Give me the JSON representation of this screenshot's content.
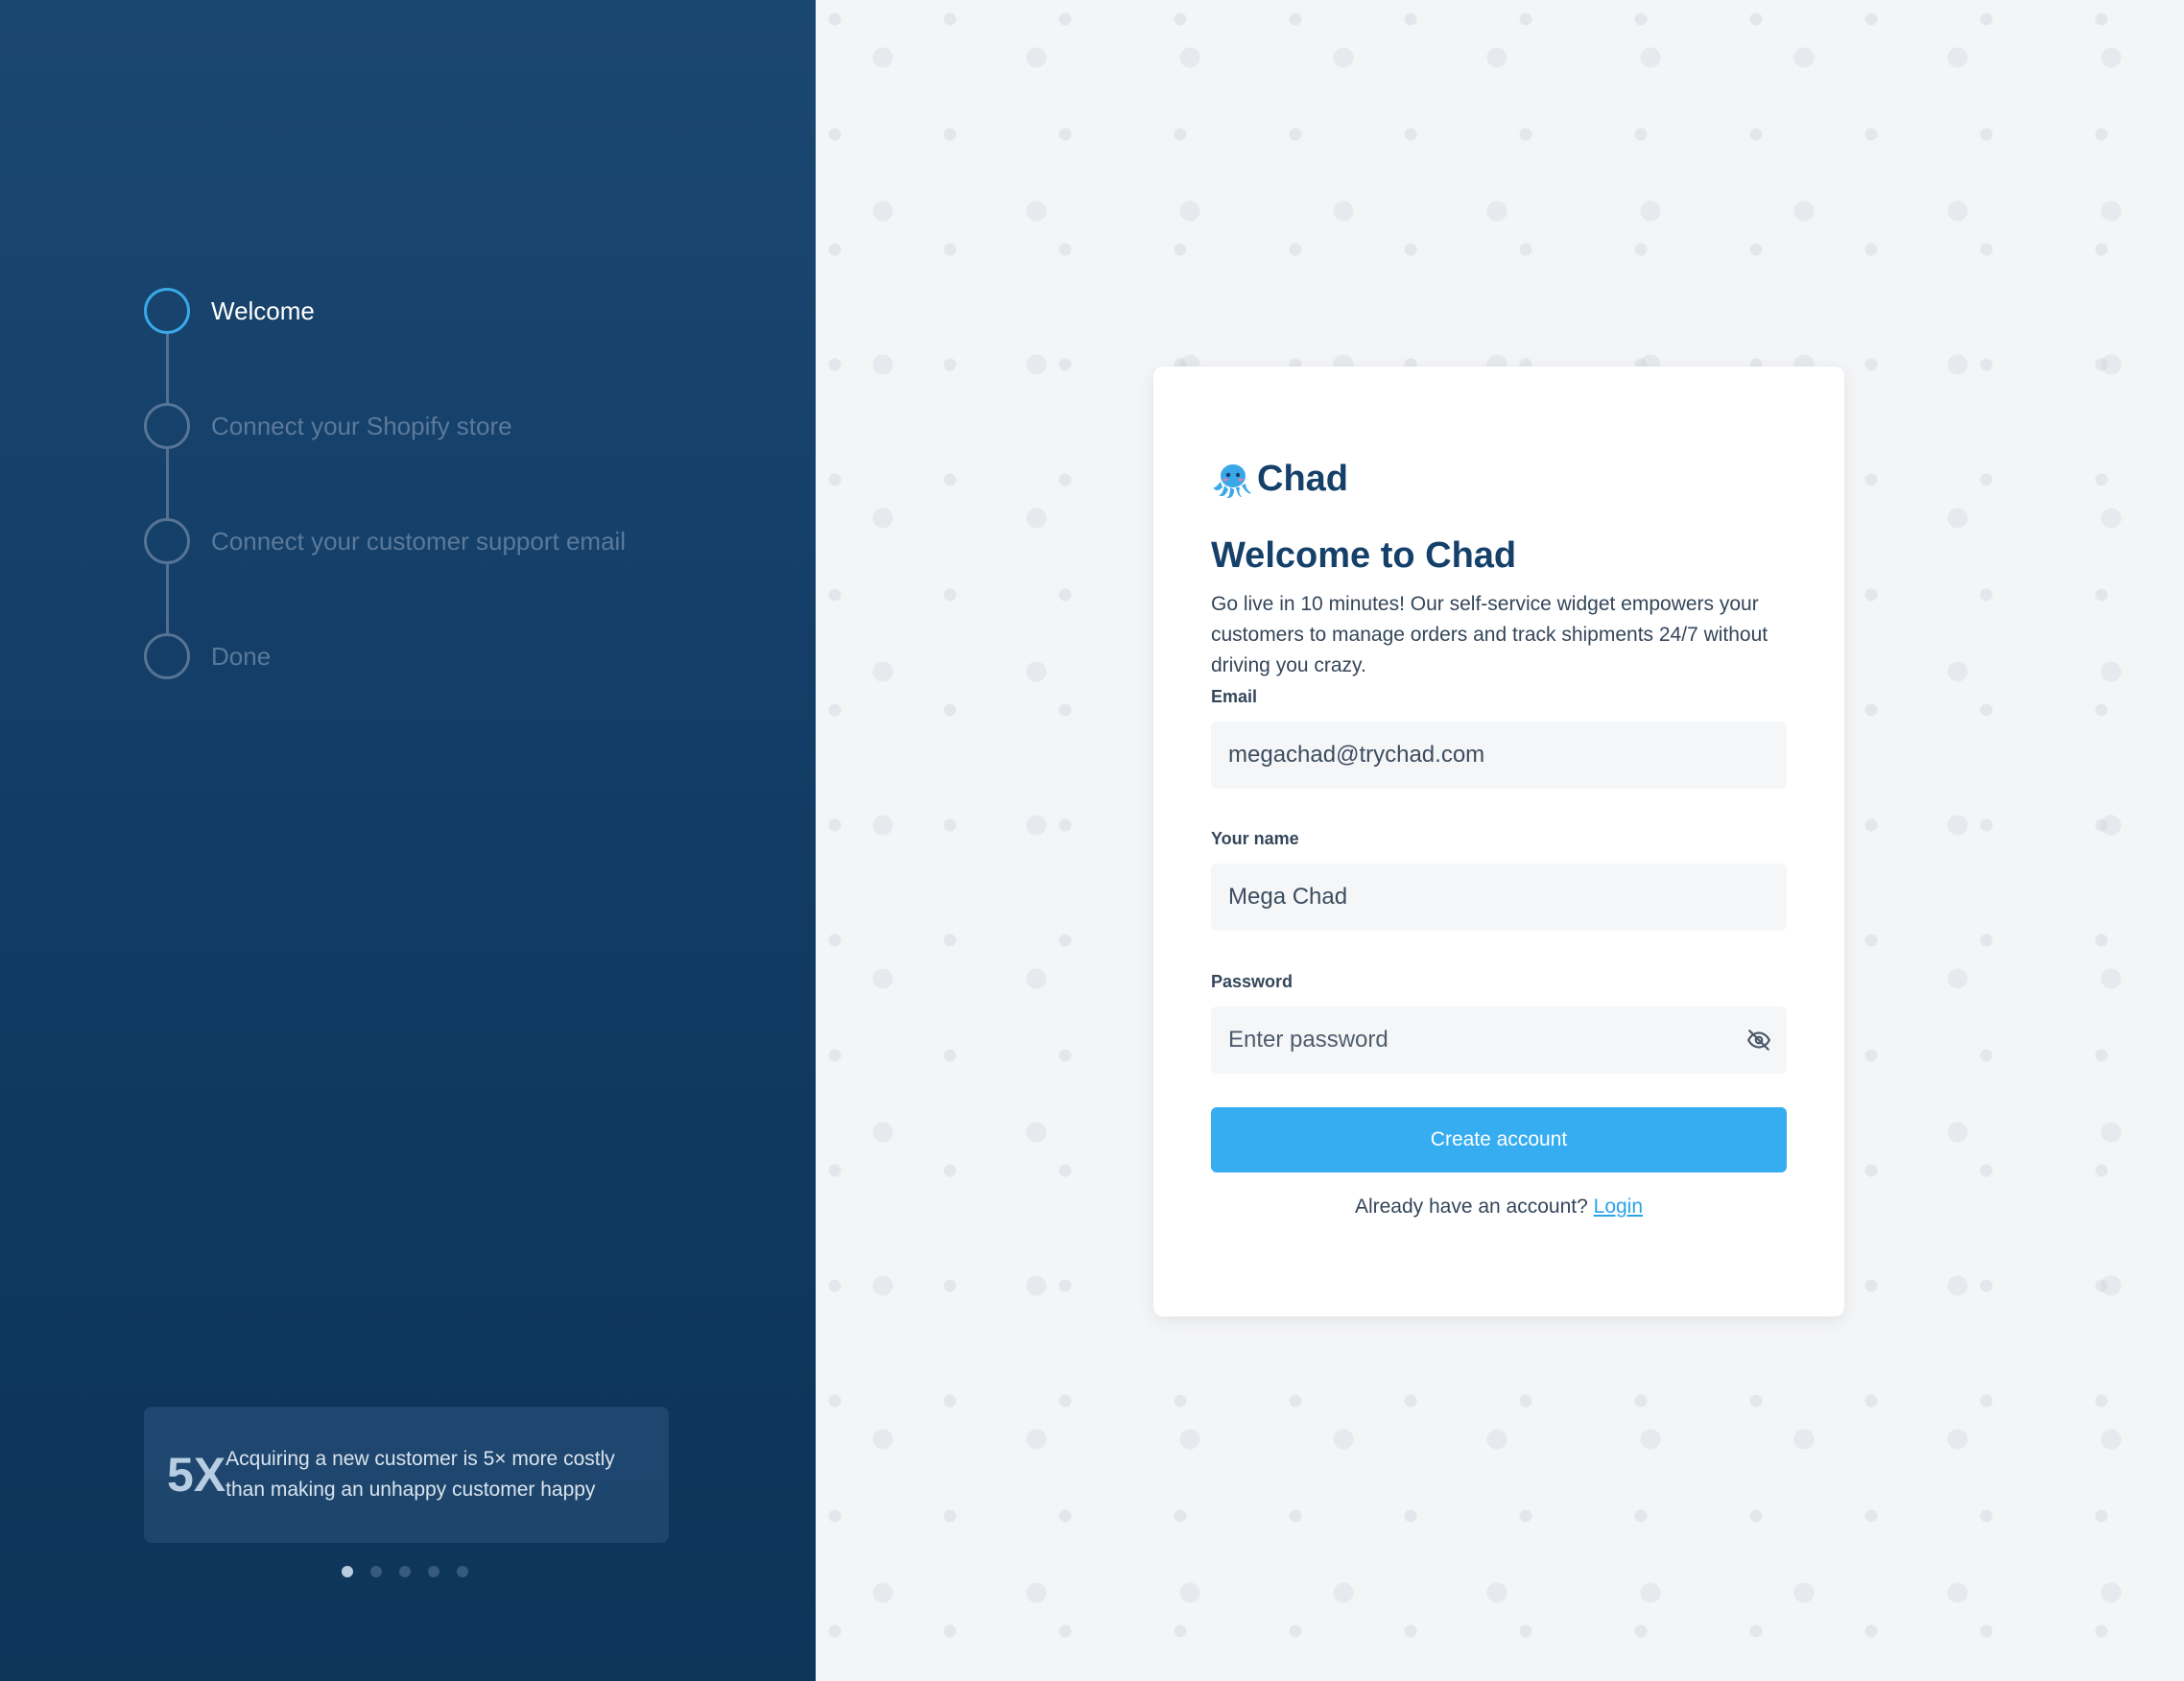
{
  "steps": [
    {
      "label": "Welcome",
      "active": true
    },
    {
      "label": "Connect your Shopify store",
      "active": false
    },
    {
      "label": "Connect your customer support email",
      "active": false
    },
    {
      "label": "Done",
      "active": false
    }
  ],
  "stat": {
    "number": "5X",
    "text": "Acquiring a new customer is 5× more costly than making an unhappy customer happy"
  },
  "carousel": {
    "count": 5,
    "active_index": 0
  },
  "brand": {
    "name": "Chad",
    "logo_icon": "octopus-icon",
    "accent": "#35adf0",
    "navy": "#15406a"
  },
  "form": {
    "title": "Welcome to Chad",
    "subtitle": "Go live in 10 minutes! Our self-service widget empowers your customers to manage orders and track shipments 24/7 without driving you crazy.",
    "email_label": "Email",
    "email_value": "megachad@trychad.com",
    "name_label": "Your name",
    "name_value": "Mega Chad",
    "password_label": "Password",
    "password_placeholder": "Enter password",
    "password_toggle_icon": "eye-slash-icon",
    "submit_label": "Create account",
    "login_prompt": "Already have an account?",
    "login_link": "Login"
  }
}
